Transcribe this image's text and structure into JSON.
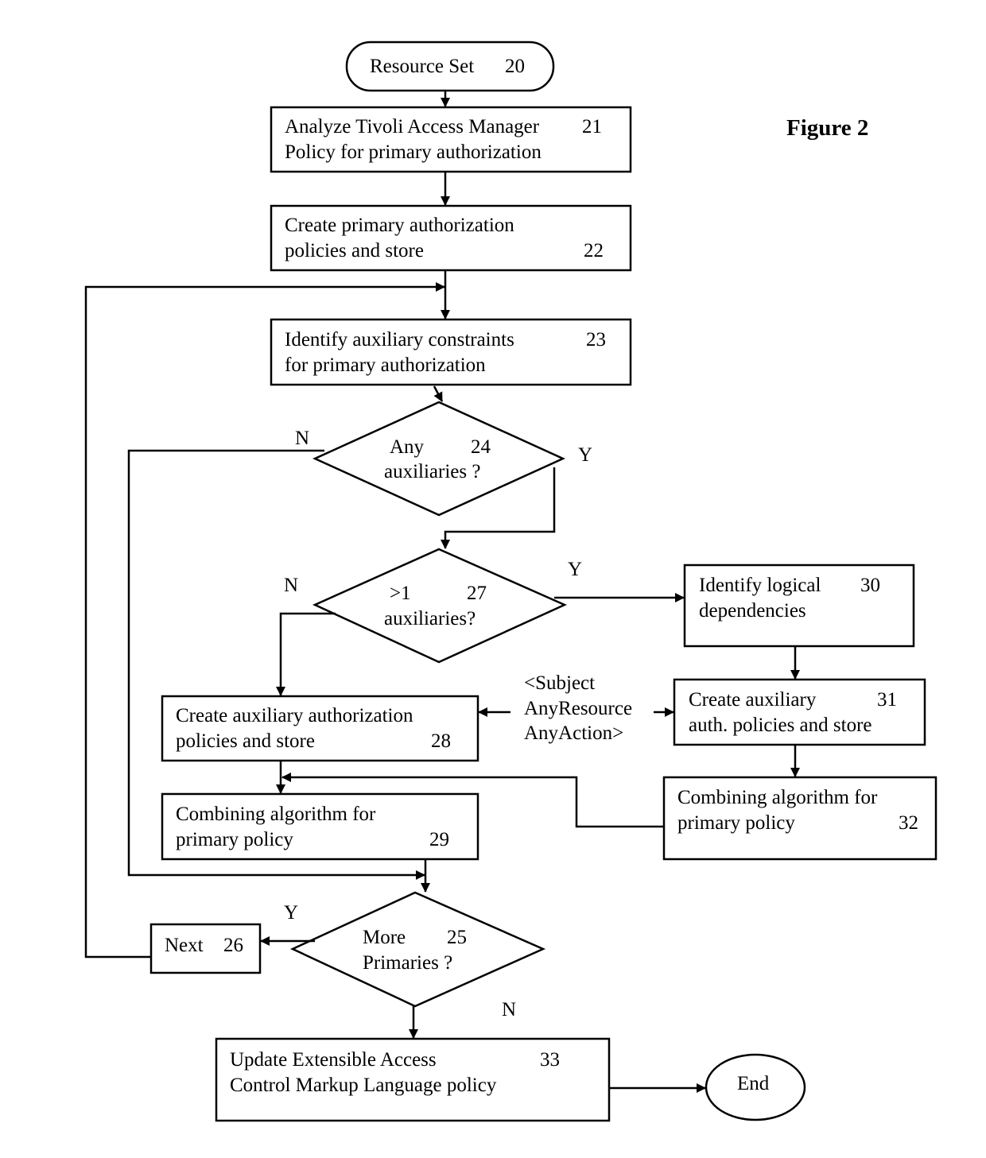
{
  "figure_title": "Figure 2",
  "nodes": {
    "n20": {
      "line1": "Resource Set",
      "num": "20"
    },
    "n21": {
      "line1": "Analyze Tivoli Access Manager",
      "line2": "Policy for primary authorization",
      "num": "21"
    },
    "n22": {
      "line1": "Create primary authorization",
      "line2": "policies and store",
      "num": "22"
    },
    "n23": {
      "line1": "Identify auxiliary constraints",
      "line2": "for primary authorization",
      "num": "23"
    },
    "n24": {
      "line1": "Any",
      "line2": "auxiliaries ?",
      "num": "24"
    },
    "n27": {
      "line1": ">1",
      "line2": "auxiliaries?",
      "num": "27"
    },
    "n30": {
      "line1": "Identify logical",
      "line2": "dependencies",
      "num": "30"
    },
    "n28": {
      "line1": "Create auxiliary authorization",
      "line2": "policies and store",
      "num": "28"
    },
    "n31": {
      "line1": "Create auxiliary",
      "line2": "auth. policies and store",
      "num": "31"
    },
    "n29": {
      "line1": "Combining algorithm for",
      "line2": "primary policy",
      "num": "29"
    },
    "n32": {
      "line1": "Combining algorithm for",
      "line2": "primary policy",
      "num": "32"
    },
    "n25": {
      "line1": "More",
      "line2": "Primaries ?",
      "num": "25"
    },
    "n26": {
      "line1": "Next",
      "num": "26"
    },
    "n33": {
      "line1": "Update Extensible Access",
      "line2": "Control Markup Language policy",
      "num": "33"
    },
    "end": {
      "line1": "End"
    }
  },
  "annotation": {
    "line1": "<Subject",
    "line2": "AnyResource",
    "line3": "AnyAction>"
  },
  "edge_labels": {
    "n24_no": "N",
    "n24_yes": "Y",
    "n27_no": "N",
    "n27_yes": "Y",
    "n25_yes": "Y",
    "n25_no": "N"
  }
}
